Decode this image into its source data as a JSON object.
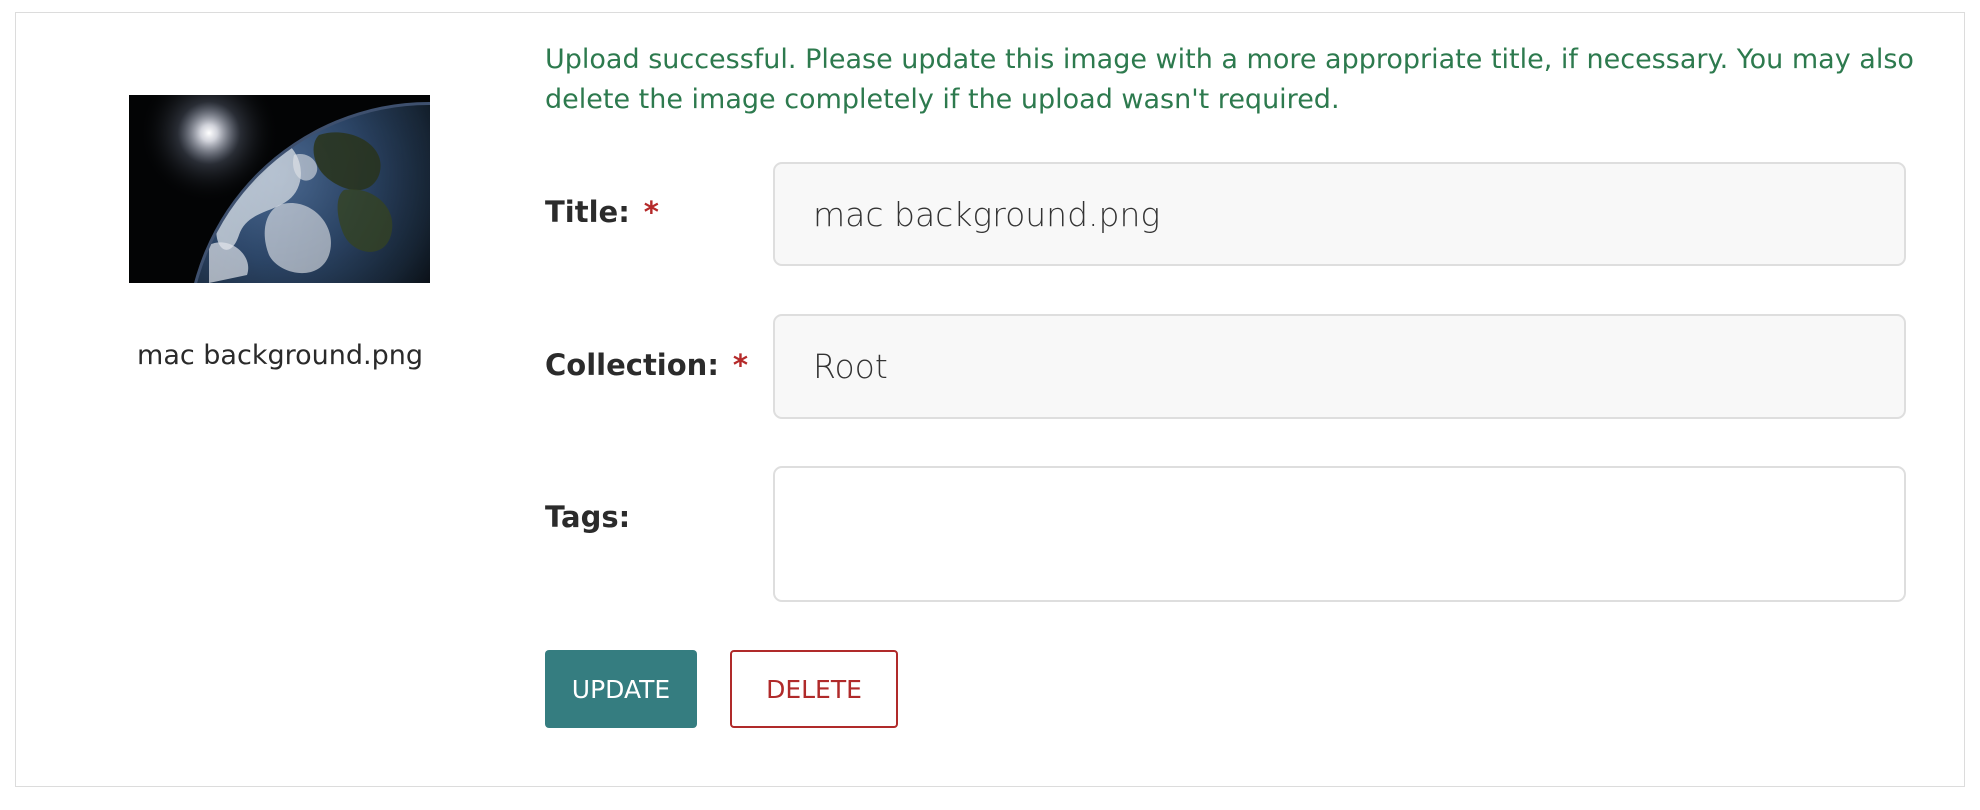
{
  "upload": {
    "message": "Upload successful. Please update this image with a more appropriate title, if necessary. You may also delete the image completely if the upload wasn't required."
  },
  "preview": {
    "caption": "mac background.png",
    "image_description": "earth-from-space"
  },
  "form": {
    "title_label": "Title:",
    "title_value": "mac background.png",
    "collection_label": "Collection:",
    "collection_value": "Root",
    "tags_label": "Tags:",
    "tags_value": "",
    "required_marker": "*"
  },
  "actions": {
    "update_label": "UPDATE",
    "delete_label": "DELETE"
  },
  "colors": {
    "success_text": "#2d7a4e",
    "primary_button": "#357d80",
    "danger": "#b02a2a",
    "required_marker": "#b52a2a"
  }
}
